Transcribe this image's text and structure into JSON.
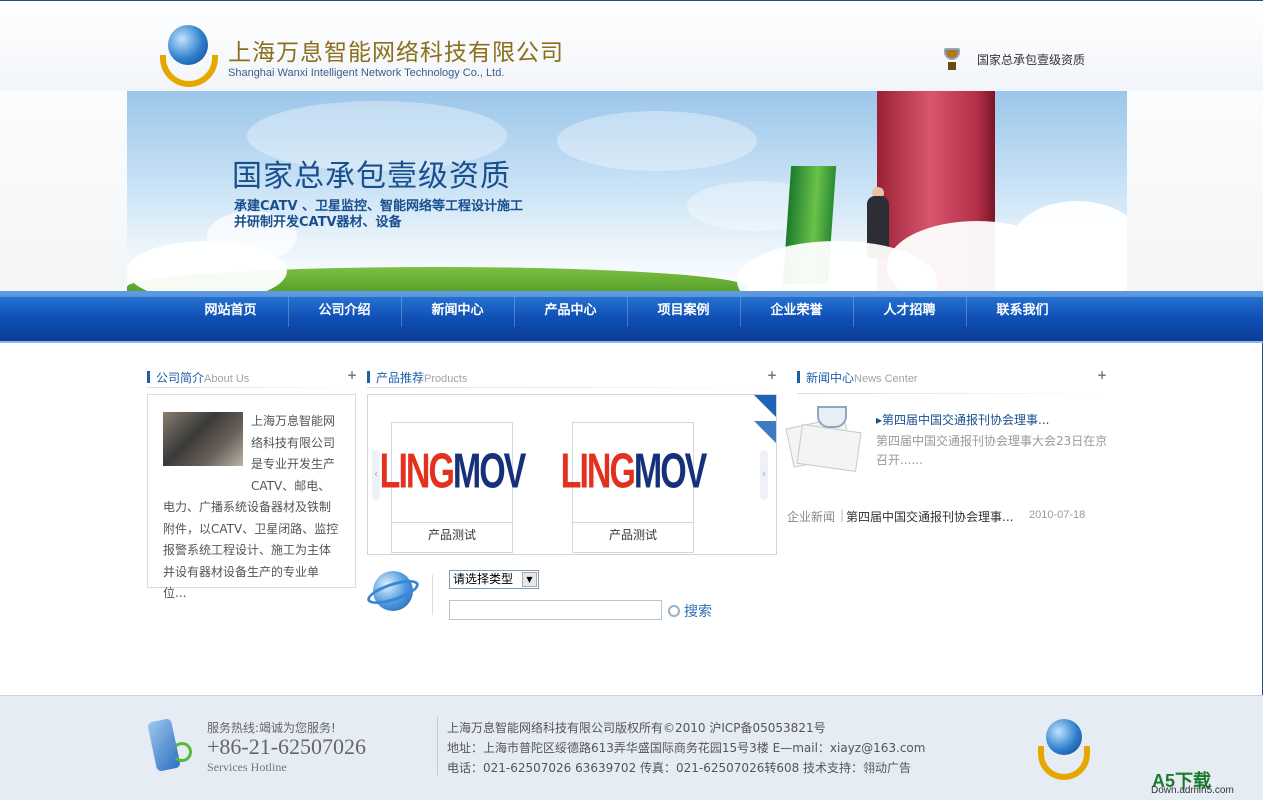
{
  "header": {
    "company_cn": "上海万息智能网络科技有限公司",
    "company_en": "Shanghai Wanxi Intelligent Network Technology Co., Ltd.",
    "qualification": "国家总承包壹级资质"
  },
  "banner": {
    "title": "国家总承包壹级资质",
    "line1": "承建CATV 、卫星监控、智能网络等工程设计施工",
    "line2": "并研制开发CATV器材、设备"
  },
  "nav": {
    "items": [
      "网站首页",
      "公司介绍",
      "新闻中心",
      "产品中心",
      "项目案例",
      "企业荣誉",
      "人才招聘",
      "联系我们"
    ]
  },
  "about": {
    "title_cn": "公司简介",
    "title_en": "About Us",
    "more": "+",
    "text": "上海万息智能网络科技有限公司是专业开发生产CATV、邮电、电力、广播系统设备器材及铁制附件，以CATV、卫星闭路、监控报警系统工程设计、施工为主体并设有器材设备生产的专业单位..."
  },
  "products": {
    "title_cn": "产品推荐",
    "title_en": "Products",
    "more": "+",
    "items": [
      {
        "logo_red": "LING",
        "logo_blue": "MOV",
        "name": "产品测试"
      },
      {
        "logo_red": "LING",
        "logo_blue": "MOV",
        "name": "产品测试"
      }
    ]
  },
  "search": {
    "select_value": "请选择类型",
    "input_value": "",
    "button_label": "搜索"
  },
  "news": {
    "title_cn": "新闻中心",
    "title_en": "News Center",
    "more": "+",
    "headline": "第四届中国交通报刊协会理事...",
    "summary": "第四届中国交通报刊协会理事大会23日在京召开......",
    "list": [
      {
        "category": "企业新闻",
        "title": "第四届中国交通报刊协会理事...",
        "date": "2010-07-18"
      }
    ]
  },
  "footer": {
    "hotline_label": "服务热线:竭诚为您服务!",
    "hotline_number": "+86-21-62507026",
    "hotline_en": "Services Hotline",
    "copyright": "上海万息智能网络科技有限公司版权所有©2010 沪ICP备05053821号",
    "address": "地址：上海市普陀区绥德路613弄华盛国际商务花园15号3楼 E—mail：xiayz@163.com",
    "phone": "电话：021-62507026 63639702   传真：021-62507026转608    技术支持：翎动广告"
  },
  "watermark": {
    "main": "A5下载",
    "sub": "Down.admin5.com"
  },
  "colors": {
    "nav_blue": "#0f4fb4",
    "brand_blue": "#1d5fa8",
    "logo_gold": "#e6a800",
    "footer_bg": "#e6ecf3"
  }
}
